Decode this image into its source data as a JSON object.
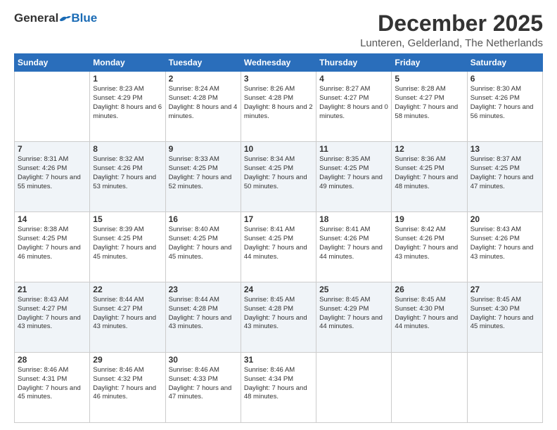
{
  "header": {
    "logo": {
      "general": "General",
      "blue": "Blue"
    },
    "title": "December 2025",
    "subtitle": "Lunteren, Gelderland, The Netherlands"
  },
  "calendar": {
    "days_of_week": [
      "Sunday",
      "Monday",
      "Tuesday",
      "Wednesday",
      "Thursday",
      "Friday",
      "Saturday"
    ],
    "weeks": [
      [
        {
          "day": "",
          "sunrise": "",
          "sunset": "",
          "daylight": ""
        },
        {
          "day": "1",
          "sunrise": "Sunrise: 8:23 AM",
          "sunset": "Sunset: 4:29 PM",
          "daylight": "Daylight: 8 hours and 6 minutes."
        },
        {
          "day": "2",
          "sunrise": "Sunrise: 8:24 AM",
          "sunset": "Sunset: 4:28 PM",
          "daylight": "Daylight: 8 hours and 4 minutes."
        },
        {
          "day": "3",
          "sunrise": "Sunrise: 8:26 AM",
          "sunset": "Sunset: 4:28 PM",
          "daylight": "Daylight: 8 hours and 2 minutes."
        },
        {
          "day": "4",
          "sunrise": "Sunrise: 8:27 AM",
          "sunset": "Sunset: 4:27 PM",
          "daylight": "Daylight: 8 hours and 0 minutes."
        },
        {
          "day": "5",
          "sunrise": "Sunrise: 8:28 AM",
          "sunset": "Sunset: 4:27 PM",
          "daylight": "Daylight: 7 hours and 58 minutes."
        },
        {
          "day": "6",
          "sunrise": "Sunrise: 8:30 AM",
          "sunset": "Sunset: 4:26 PM",
          "daylight": "Daylight: 7 hours and 56 minutes."
        }
      ],
      [
        {
          "day": "7",
          "sunrise": "Sunrise: 8:31 AM",
          "sunset": "Sunset: 4:26 PM",
          "daylight": "Daylight: 7 hours and 55 minutes."
        },
        {
          "day": "8",
          "sunrise": "Sunrise: 8:32 AM",
          "sunset": "Sunset: 4:26 PM",
          "daylight": "Daylight: 7 hours and 53 minutes."
        },
        {
          "day": "9",
          "sunrise": "Sunrise: 8:33 AM",
          "sunset": "Sunset: 4:25 PM",
          "daylight": "Daylight: 7 hours and 52 minutes."
        },
        {
          "day": "10",
          "sunrise": "Sunrise: 8:34 AM",
          "sunset": "Sunset: 4:25 PM",
          "daylight": "Daylight: 7 hours and 50 minutes."
        },
        {
          "day": "11",
          "sunrise": "Sunrise: 8:35 AM",
          "sunset": "Sunset: 4:25 PM",
          "daylight": "Daylight: 7 hours and 49 minutes."
        },
        {
          "day": "12",
          "sunrise": "Sunrise: 8:36 AM",
          "sunset": "Sunset: 4:25 PM",
          "daylight": "Daylight: 7 hours and 48 minutes."
        },
        {
          "day": "13",
          "sunrise": "Sunrise: 8:37 AM",
          "sunset": "Sunset: 4:25 PM",
          "daylight": "Daylight: 7 hours and 47 minutes."
        }
      ],
      [
        {
          "day": "14",
          "sunrise": "Sunrise: 8:38 AM",
          "sunset": "Sunset: 4:25 PM",
          "daylight": "Daylight: 7 hours and 46 minutes."
        },
        {
          "day": "15",
          "sunrise": "Sunrise: 8:39 AM",
          "sunset": "Sunset: 4:25 PM",
          "daylight": "Daylight: 7 hours and 45 minutes."
        },
        {
          "day": "16",
          "sunrise": "Sunrise: 8:40 AM",
          "sunset": "Sunset: 4:25 PM",
          "daylight": "Daylight: 7 hours and 45 minutes."
        },
        {
          "day": "17",
          "sunrise": "Sunrise: 8:41 AM",
          "sunset": "Sunset: 4:25 PM",
          "daylight": "Daylight: 7 hours and 44 minutes."
        },
        {
          "day": "18",
          "sunrise": "Sunrise: 8:41 AM",
          "sunset": "Sunset: 4:26 PM",
          "daylight": "Daylight: 7 hours and 44 minutes."
        },
        {
          "day": "19",
          "sunrise": "Sunrise: 8:42 AM",
          "sunset": "Sunset: 4:26 PM",
          "daylight": "Daylight: 7 hours and 43 minutes."
        },
        {
          "day": "20",
          "sunrise": "Sunrise: 8:43 AM",
          "sunset": "Sunset: 4:26 PM",
          "daylight": "Daylight: 7 hours and 43 minutes."
        }
      ],
      [
        {
          "day": "21",
          "sunrise": "Sunrise: 8:43 AM",
          "sunset": "Sunset: 4:27 PM",
          "daylight": "Daylight: 7 hours and 43 minutes."
        },
        {
          "day": "22",
          "sunrise": "Sunrise: 8:44 AM",
          "sunset": "Sunset: 4:27 PM",
          "daylight": "Daylight: 7 hours and 43 minutes."
        },
        {
          "day": "23",
          "sunrise": "Sunrise: 8:44 AM",
          "sunset": "Sunset: 4:28 PM",
          "daylight": "Daylight: 7 hours and 43 minutes."
        },
        {
          "day": "24",
          "sunrise": "Sunrise: 8:45 AM",
          "sunset": "Sunset: 4:28 PM",
          "daylight": "Daylight: 7 hours and 43 minutes."
        },
        {
          "day": "25",
          "sunrise": "Sunrise: 8:45 AM",
          "sunset": "Sunset: 4:29 PM",
          "daylight": "Daylight: 7 hours and 44 minutes."
        },
        {
          "day": "26",
          "sunrise": "Sunrise: 8:45 AM",
          "sunset": "Sunset: 4:30 PM",
          "daylight": "Daylight: 7 hours and 44 minutes."
        },
        {
          "day": "27",
          "sunrise": "Sunrise: 8:45 AM",
          "sunset": "Sunset: 4:30 PM",
          "daylight": "Daylight: 7 hours and 45 minutes."
        }
      ],
      [
        {
          "day": "28",
          "sunrise": "Sunrise: 8:46 AM",
          "sunset": "Sunset: 4:31 PM",
          "daylight": "Daylight: 7 hours and 45 minutes."
        },
        {
          "day": "29",
          "sunrise": "Sunrise: 8:46 AM",
          "sunset": "Sunset: 4:32 PM",
          "daylight": "Daylight: 7 hours and 46 minutes."
        },
        {
          "day": "30",
          "sunrise": "Sunrise: 8:46 AM",
          "sunset": "Sunset: 4:33 PM",
          "daylight": "Daylight: 7 hours and 47 minutes."
        },
        {
          "day": "31",
          "sunrise": "Sunrise: 8:46 AM",
          "sunset": "Sunset: 4:34 PM",
          "daylight": "Daylight: 7 hours and 48 minutes."
        },
        {
          "day": "",
          "sunrise": "",
          "sunset": "",
          "daylight": ""
        },
        {
          "day": "",
          "sunrise": "",
          "sunset": "",
          "daylight": ""
        },
        {
          "day": "",
          "sunrise": "",
          "sunset": "",
          "daylight": ""
        }
      ]
    ]
  }
}
